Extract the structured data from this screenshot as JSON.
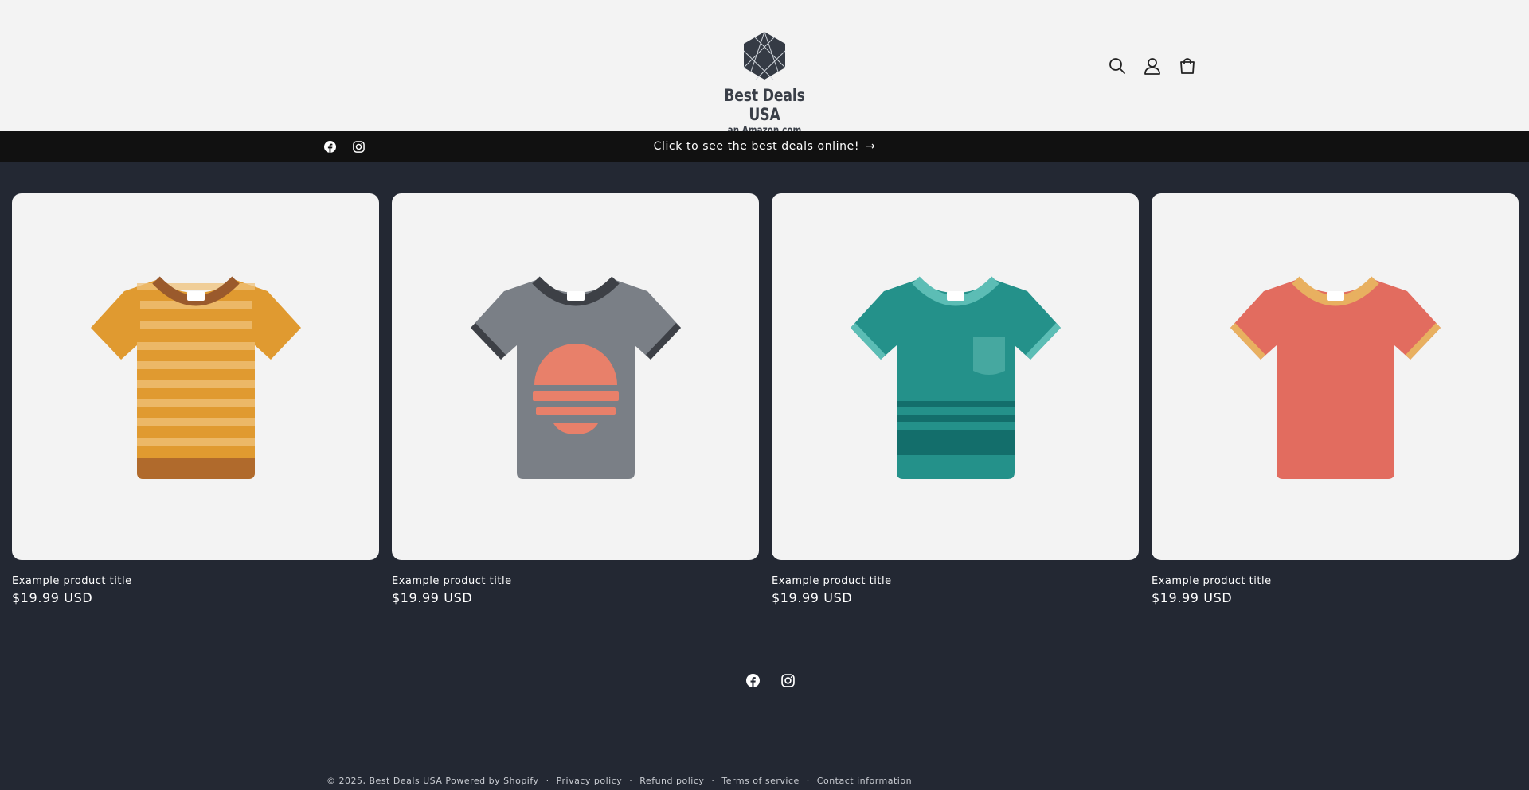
{
  "header": {
    "logo_title": "Best Deals USA",
    "logo_subtitle": "an Amazon.com Affiliate",
    "icons": [
      "search-icon",
      "account-icon",
      "cart-icon"
    ]
  },
  "announcement": {
    "text": "Click to see the best deals online!",
    "arrow": "→",
    "social": [
      "facebook-icon",
      "instagram-icon"
    ]
  },
  "products": [
    {
      "title": "Example product title",
      "price": "$19.99 USD",
      "color": "#e09a30"
    },
    {
      "title": "Example product title",
      "price": "$19.99 USD",
      "color": "#7a7f86"
    },
    {
      "title": "Example product title",
      "price": "$19.99 USD",
      "color": "#24918a"
    },
    {
      "title": "Example product title",
      "price": "$19.99 USD",
      "color": "#e26c5f"
    }
  ],
  "footer": {
    "copyright": "© 2025,",
    "store_name": "Best Deals USA",
    "powered": "Powered by Shopify",
    "separator": "·",
    "links": [
      "Privacy policy",
      "Refund policy",
      "Terms of service",
      "Contact information"
    ]
  },
  "colors": {
    "header_bg": "#f3f3f3",
    "announce_bg": "#111111",
    "page_bg": "#232833",
    "card_bg": "#f3f3f3"
  }
}
